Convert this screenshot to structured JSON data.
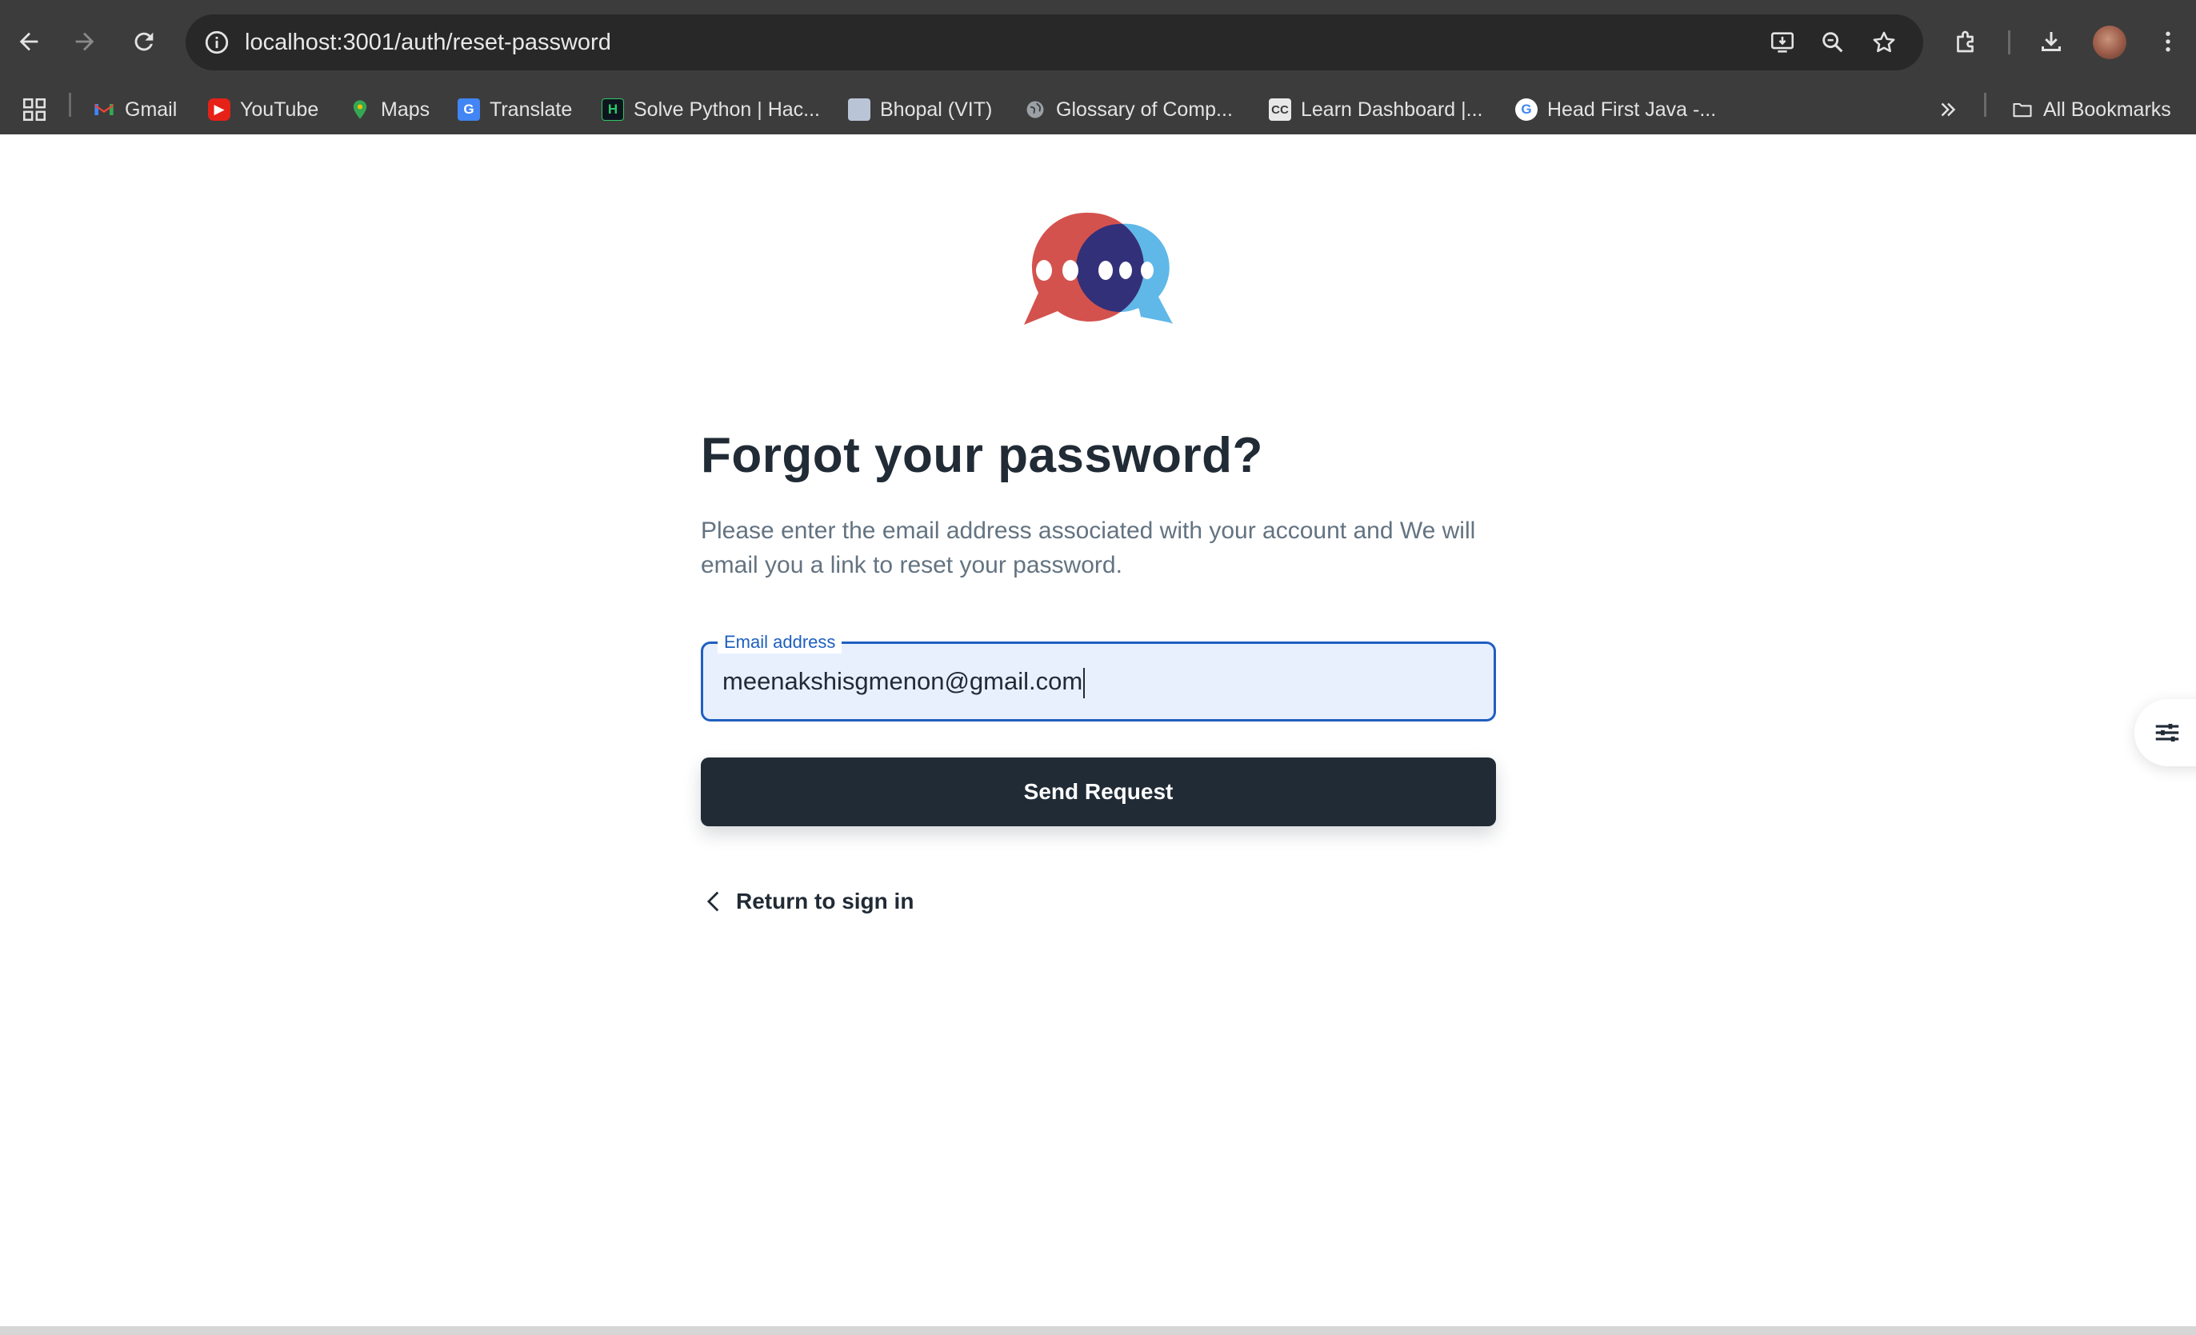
{
  "browser": {
    "url": "localhost:3001/auth/reset-password",
    "bookmarks": [
      {
        "label": "Gmail",
        "icon": "gmail-icon"
      },
      {
        "label": "YouTube",
        "icon": "youtube-icon"
      },
      {
        "label": "Maps",
        "icon": "maps-icon"
      },
      {
        "label": "Translate",
        "icon": "translate-icon"
      },
      {
        "label": "Solve Python | Hac...",
        "icon": "hackerrank-icon"
      },
      {
        "label": "Bhopal (VIT)",
        "icon": "page-icon"
      },
      {
        "label": "Glossary of Comp...",
        "icon": "globe-icon"
      },
      {
        "label": "Learn Dashboard |...",
        "icon": "cc-icon"
      },
      {
        "label": "Head First Java -...",
        "icon": "google-icon"
      }
    ],
    "all_bookmarks_label": "All Bookmarks"
  },
  "reset": {
    "title": "Forgot your password?",
    "description": "Please enter the email address associated with your account and We will email you a link to reset your password.",
    "email_label": "Email address",
    "email_value": "meenakshisgmenon@gmail.com",
    "submit_label": "Send Request",
    "return_label": "Return to sign in"
  },
  "colors": {
    "primary_dark": "#212b36",
    "focus_blue": "#1f5fbf",
    "logo_red": "#d4524d",
    "logo_blue": "#5fb8e8",
    "logo_overlap": "#33307a"
  }
}
